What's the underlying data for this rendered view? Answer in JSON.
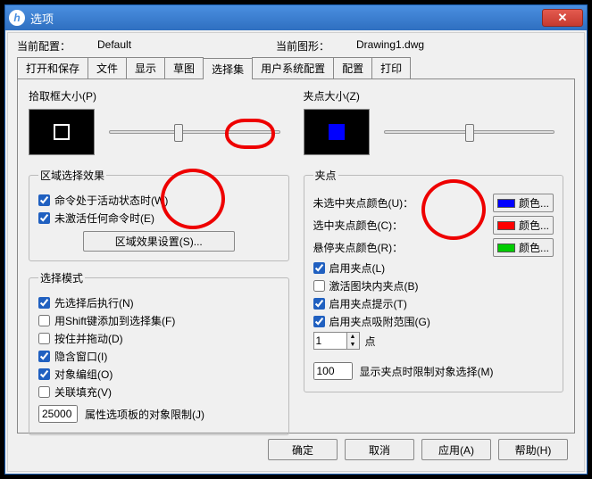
{
  "window": {
    "title": "选项"
  },
  "config": {
    "current_config_label": "当前配置：",
    "current_config_value": "Default",
    "current_drawing_label": "当前图形：",
    "current_drawing_value": "Drawing1.dwg"
  },
  "tabs": [
    "打开和保存",
    "文件",
    "显示",
    "草图",
    "选择集",
    "用户系统配置",
    "配置",
    "打印"
  ],
  "active_tab_index": 4,
  "pickbox": {
    "label": "拾取框大小(P)",
    "slider_pos_pct": 38
  },
  "grip_size": {
    "label": "夹点大小(Z)",
    "slider_pos_pct": 48
  },
  "region": {
    "legend": "区域选择效果",
    "chk_active": {
      "checked": true,
      "label": "命令处于活动状态时(W)"
    },
    "chk_no_cmd": {
      "checked": true,
      "label": "未激活任何命令时(E)"
    },
    "settings_btn": "区域效果设置(S)..."
  },
  "select_mode": {
    "legend": "选择模式",
    "chk_pre": {
      "checked": true,
      "label": "先选择后执行(N)"
    },
    "chk_shift": {
      "checked": false,
      "label": "用Shift键添加到选择集(F)"
    },
    "chk_press": {
      "checked": false,
      "label": "按住并拖动(D)"
    },
    "chk_imp": {
      "checked": true,
      "label": "隐含窗口(I)"
    },
    "chk_grp": {
      "checked": true,
      "label": "对象编组(O)"
    },
    "chk_hatch": {
      "checked": false,
      "label": "关联填充(V)"
    },
    "limit_value": "25000",
    "limit_label": "属性选项板的对象限制(J)"
  },
  "grips": {
    "legend": "夹点",
    "unsel_label": "未选中夹点颜色(U)：",
    "sel_label": "选中夹点颜色(C)：",
    "hover_label": "悬停夹点颜色(R)：",
    "color_btn_text": "颜色...",
    "colors": {
      "unsel": "#0000ff",
      "sel": "#ff0000",
      "hover": "#00cc00"
    },
    "chk_enable": {
      "checked": true,
      "label": "启用夹点(L)"
    },
    "chk_block": {
      "checked": false,
      "label": "激活图块内夹点(B)"
    },
    "chk_tips": {
      "checked": true,
      "label": "启用夹点提示(T)"
    },
    "chk_snap": {
      "checked": true,
      "label": "启用夹点吸附范围(G)"
    },
    "spin_value": "1",
    "spin_suffix": "点",
    "disp_limit_value": "100",
    "disp_limit_label": "显示夹点时限制对象选择(M)"
  },
  "buttons": {
    "ok": "确定",
    "cancel": "取消",
    "apply": "应用(A)",
    "help": "帮助(H)"
  }
}
